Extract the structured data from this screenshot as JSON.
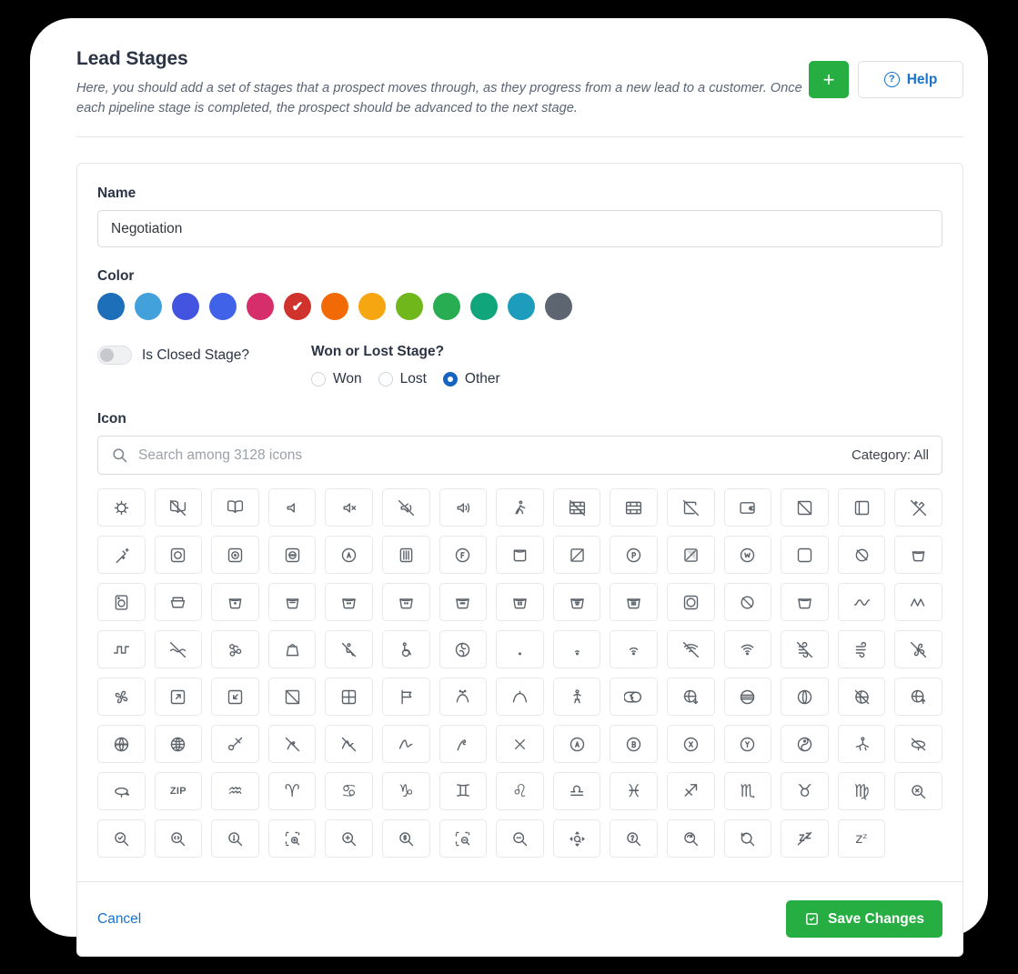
{
  "header": {
    "title": "Lead Stages",
    "description": "Here, you should add a set of stages that a prospect moves through, as they progress from a new lead to a customer. Once each pipeline stage is completed, the prospect should be advanced to the next stage.",
    "add_label": "+",
    "add_icon": "plus-icon",
    "help_label": "Help",
    "help_icon": "question-circle-icon",
    "accent_green": "#27ae42",
    "accent_blue": "#1a73c9"
  },
  "form": {
    "name_label": "Name",
    "name_value": "Negotiation",
    "name_placeholder": "",
    "color_label": "Color",
    "colors": [
      {
        "hex": "#1c6fb8",
        "selected": false
      },
      {
        "hex": "#42a0da",
        "selected": false
      },
      {
        "hex": "#4355e0",
        "selected": false
      },
      {
        "hex": "#4062e8",
        "selected": false
      },
      {
        "hex": "#d52e6a",
        "selected": false
      },
      {
        "hex": "#d0332c",
        "selected": true
      },
      {
        "hex": "#f26a06",
        "selected": false
      },
      {
        "hex": "#f5a611",
        "selected": false
      },
      {
        "hex": "#6fb71b",
        "selected": false
      },
      {
        "hex": "#29ad52",
        "selected": false
      },
      {
        "hex": "#11a57c",
        "selected": false
      },
      {
        "hex": "#1e9cbb",
        "selected": false
      },
      {
        "hex": "#5d6670",
        "selected": false
      }
    ],
    "selected_check": "✔",
    "toggle_label": "Is Closed Stage?",
    "toggle_on": false,
    "radio_title": "Won or Lost Stage?",
    "radios": [
      {
        "label": "Won",
        "selected": false
      },
      {
        "label": "Lost",
        "selected": false
      },
      {
        "label": "Other",
        "selected": true
      }
    ],
    "radio_selected_color": "#1565c0",
    "icon_label": "Icon",
    "search_placeholder": "Search among 3128 icons",
    "search_value": "",
    "search_icon": "search-icon",
    "category_text": "Category: All"
  },
  "icon_grid": {
    "rows": [
      [
        {
          "name": "virus-icon",
          "type": "svg",
          "id": "virus"
        },
        {
          "name": "book-off-icon",
          "type": "svg",
          "id": "book-off"
        },
        {
          "name": "book-open-icon",
          "type": "svg",
          "id": "book-open"
        },
        {
          "name": "volume-icon",
          "type": "svg",
          "id": "volume"
        },
        {
          "name": "volume-x-icon",
          "type": "svg",
          "id": "volume-x"
        },
        {
          "name": "volume-off-icon",
          "type": "svg",
          "id": "volume-off"
        },
        {
          "name": "volume-high-icon",
          "type": "svg",
          "id": "volume-high"
        },
        {
          "name": "walk-icon",
          "type": "svg",
          "id": "walk"
        },
        {
          "name": "wall-off-icon",
          "type": "svg",
          "id": "wall-off"
        },
        {
          "name": "wall-icon",
          "type": "svg",
          "id": "wall"
        },
        {
          "name": "wallet-off-icon",
          "type": "svg",
          "id": "wallet-off"
        },
        {
          "name": "wallet-icon",
          "type": "svg",
          "id": "wallet"
        },
        {
          "name": "wallpaper-off-icon",
          "type": "svg",
          "id": "wallpaper-off"
        },
        {
          "name": "wallpaper-icon",
          "type": "svg",
          "id": "wallpaper"
        },
        {
          "name": "wand-off-icon",
          "type": "svg",
          "id": "wand-off"
        },
        {
          "name": "wand-icon",
          "type": "svg",
          "id": "wand"
        },
        {
          "name": "wash-dry-icon",
          "type": "svg",
          "id": "wash-dry-circle"
        }
      ],
      [
        {
          "name": "wash-dry-1-icon",
          "type": "svg",
          "id": "wash-dry-1"
        },
        {
          "name": "wash-dry-3-icon",
          "type": "svg",
          "id": "wash-dry-3"
        },
        {
          "name": "wash-dry-a-icon",
          "type": "svg",
          "id": "wash-dry-a"
        },
        {
          "name": "wash-dry-dip-icon",
          "type": "svg",
          "id": "wash-dry-dip"
        },
        {
          "name": "wash-dry-f-icon",
          "type": "svg",
          "id": "wash-dry-f"
        },
        {
          "name": "wash-dry-hang-icon",
          "type": "svg",
          "id": "wash-dry-hang"
        },
        {
          "name": "wash-dry-off-icon",
          "type": "svg",
          "id": "wash-dry-off"
        },
        {
          "name": "wash-dry-p-icon",
          "type": "svg",
          "id": "wash-dry-p"
        },
        {
          "name": "wash-dry-shade-icon",
          "type": "svg",
          "id": "wash-dry-shade"
        },
        {
          "name": "wash-dry-w-icon",
          "type": "svg",
          "id": "wash-dry-w"
        },
        {
          "name": "wash-dryclean-icon",
          "type": "svg",
          "id": "wash-dryclean"
        },
        {
          "name": "wash-dryclean-off-icon",
          "type": "svg",
          "id": "wash-dryclean-off"
        },
        {
          "name": "wash-gentle-icon",
          "type": "svg",
          "id": "wash-gentle"
        },
        {
          "name": "wash-machine-icon",
          "type": "svg",
          "id": "wash-machine"
        },
        {
          "name": "wash-press-icon",
          "type": "svg",
          "id": "wash-press"
        },
        {
          "name": "wash-temp-icon",
          "type": "svg",
          "id": "wash-temp"
        },
        {
          "name": "wash-basket-icon",
          "type": "svg",
          "id": "wash-basket"
        }
      ],
      [
        {
          "name": "wash-temp-1-icon",
          "type": "svg",
          "id": "wash-t1"
        },
        {
          "name": "wash-temp-2-icon",
          "type": "svg",
          "id": "wash-t2"
        },
        {
          "name": "wash-temp-3-icon",
          "type": "svg",
          "id": "wash-t3"
        },
        {
          "name": "wash-temp-4-icon",
          "type": "svg",
          "id": "wash-t4"
        },
        {
          "name": "wash-temp-5-icon",
          "type": "svg",
          "id": "wash-t5"
        },
        {
          "name": "wash-temp-6-icon",
          "type": "svg",
          "id": "wash-t6"
        },
        {
          "name": "wash-tumble-dry-icon",
          "type": "svg",
          "id": "wash-tumble"
        },
        {
          "name": "wash-tumble-off-icon",
          "type": "svg",
          "id": "wash-tumble-off"
        },
        {
          "name": "wash-plain-icon",
          "type": "svg",
          "id": "wash-plain"
        },
        {
          "name": "wave-sine-icon",
          "type": "svg",
          "id": "wave-sine"
        },
        {
          "name": "wave-sawtooth-icon",
          "type": "svg",
          "id": "wave-saw"
        },
        {
          "name": "wave-square-icon",
          "type": "svg",
          "id": "wave-square"
        },
        {
          "name": "waves-off-icon",
          "type": "svg",
          "id": "waves-off"
        },
        {
          "name": "webhook-icon",
          "type": "svg",
          "id": "webhook"
        },
        {
          "name": "weight-icon",
          "type": "svg",
          "id": "weight"
        },
        {
          "name": "wheelchair-off-icon",
          "type": "svg",
          "id": "wheelchair-off"
        },
        {
          "name": "wheelchair-icon",
          "type": "svg",
          "id": "wheelchair"
        }
      ],
      [
        {
          "name": "whirl-icon",
          "type": "svg",
          "id": "whirl"
        },
        {
          "name": "wifi-0-icon",
          "type": "svg",
          "id": "wifi0"
        },
        {
          "name": "wifi-1-icon",
          "type": "svg",
          "id": "wifi1"
        },
        {
          "name": "wifi-2-icon",
          "type": "svg",
          "id": "wifi2"
        },
        {
          "name": "wifi-off-icon",
          "type": "svg",
          "id": "wifi-off"
        },
        {
          "name": "wifi-icon",
          "type": "svg",
          "id": "wifi"
        },
        {
          "name": "wind-off-icon",
          "type": "svg",
          "id": "wind-off"
        },
        {
          "name": "wind-icon",
          "type": "svg",
          "id": "wind"
        },
        {
          "name": "windmill-off-icon",
          "type": "svg",
          "id": "windmill-off"
        },
        {
          "name": "windmill-icon",
          "type": "svg",
          "id": "windmill"
        },
        {
          "name": "window-maximize-icon",
          "type": "svg",
          "id": "win-max"
        },
        {
          "name": "window-minimize-icon",
          "type": "svg",
          "id": "win-min"
        },
        {
          "name": "window-off-icon",
          "type": "svg",
          "id": "win-off"
        },
        {
          "name": "window-icon",
          "type": "svg",
          "id": "window"
        },
        {
          "name": "windsock-icon",
          "type": "svg",
          "id": "windsock"
        },
        {
          "name": "wiper-wash-icon",
          "type": "svg",
          "id": "wiper-wash"
        },
        {
          "name": "wiper-icon",
          "type": "svg",
          "id": "wiper"
        }
      ],
      [
        {
          "name": "woman-icon",
          "type": "svg",
          "id": "woman"
        },
        {
          "name": "wood-icon",
          "type": "svg",
          "id": "wood"
        },
        {
          "name": "world-download-icon",
          "type": "svg",
          "id": "world-dl"
        },
        {
          "name": "world-latitude-icon",
          "type": "svg",
          "id": "world-lat"
        },
        {
          "name": "world-longitude-icon",
          "type": "svg",
          "id": "world-lon"
        },
        {
          "name": "world-off-icon",
          "type": "svg",
          "id": "world-off"
        },
        {
          "name": "world-upload-icon",
          "type": "svg",
          "id": "world-ul"
        },
        {
          "name": "world-www-icon",
          "type": "svg",
          "id": "world-www"
        },
        {
          "name": "world-icon",
          "type": "svg",
          "id": "world"
        },
        {
          "name": "wrecking-ball-icon",
          "type": "svg",
          "id": "wrecking"
        },
        {
          "name": "writing-off-icon",
          "type": "svg",
          "id": "writing-off"
        },
        {
          "name": "writing-sign-off-icon",
          "type": "svg",
          "id": "writing-sign-off"
        },
        {
          "name": "writing-sign-icon",
          "type": "svg",
          "id": "writing-sign"
        },
        {
          "name": "writing-icon",
          "type": "svg",
          "id": "writing"
        },
        {
          "name": "x-icon",
          "type": "svg",
          "id": "x"
        },
        {
          "name": "xbox-a-icon",
          "type": "svg",
          "id": "xbox-a"
        },
        {
          "name": "xbox-b-icon",
          "type": "svg",
          "id": "xbox-b"
        }
      ],
      [
        {
          "name": "xbox-x-icon",
          "type": "svg",
          "id": "xbox-x"
        },
        {
          "name": "xbox-y-icon",
          "type": "svg",
          "id": "xbox-y"
        },
        {
          "name": "yin-yang-icon",
          "type": "svg",
          "id": "yinyang"
        },
        {
          "name": "yoga-icon",
          "type": "svg",
          "id": "yoga"
        },
        {
          "name": "zeppelin-off-icon",
          "type": "svg",
          "id": "zeppelin-off"
        },
        {
          "name": "zeppelin-icon",
          "type": "svg",
          "id": "zeppelin"
        },
        {
          "name": "zip-icon",
          "type": "text",
          "text": "ZIP"
        },
        {
          "name": "zodiac-aquarius-icon",
          "type": "glyph",
          "glyph": "♒"
        },
        {
          "name": "zodiac-aries-icon",
          "type": "glyph",
          "glyph": "♈"
        },
        {
          "name": "zodiac-cancer-icon",
          "type": "glyph",
          "glyph": "♋"
        },
        {
          "name": "zodiac-capricorn-icon",
          "type": "glyph",
          "glyph": "♑"
        },
        {
          "name": "zodiac-gemini-icon",
          "type": "glyph",
          "glyph": "♊"
        },
        {
          "name": "zodiac-leo-icon",
          "type": "glyph",
          "glyph": "♌"
        },
        {
          "name": "zodiac-libra-icon",
          "type": "glyph",
          "glyph": "♎"
        },
        {
          "name": "zodiac-pisces-icon",
          "type": "glyph",
          "glyph": "♓"
        },
        {
          "name": "zodiac-sagittarius-icon",
          "type": "glyph",
          "glyph": "♐"
        },
        {
          "name": "zodiac-scorpio-icon",
          "type": "glyph",
          "glyph": "♏"
        }
      ],
      [
        {
          "name": "zodiac-taurus-icon",
          "type": "glyph",
          "glyph": "♉"
        },
        {
          "name": "zodiac-virgo-icon",
          "type": "glyph",
          "glyph": "♍"
        },
        {
          "name": "zoom-cancel-icon",
          "type": "svg",
          "id": "zoom-cancel"
        },
        {
          "name": "zoom-check-icon",
          "type": "svg",
          "id": "zoom-check"
        },
        {
          "name": "zoom-code-icon",
          "type": "svg",
          "id": "zoom-code"
        },
        {
          "name": "zoom-exclamation-icon",
          "type": "svg",
          "id": "zoom-excl"
        },
        {
          "name": "zoom-in-area-icon",
          "type": "svg",
          "id": "zoom-in-area"
        },
        {
          "name": "zoom-in-icon",
          "type": "svg",
          "id": "zoom-in"
        },
        {
          "name": "zoom-money-icon",
          "type": "svg",
          "id": "zoom-money"
        },
        {
          "name": "zoom-out-area-icon",
          "type": "svg",
          "id": "zoom-out-area"
        },
        {
          "name": "zoom-out-icon",
          "type": "svg",
          "id": "zoom-out"
        },
        {
          "name": "zoom-pan-icon",
          "type": "svg",
          "id": "zoom-pan"
        },
        {
          "name": "zoom-question-icon",
          "type": "svg",
          "id": "zoom-question"
        },
        {
          "name": "zoom-replace-icon",
          "type": "svg",
          "id": "zoom-replace"
        },
        {
          "name": "zoom-reset-icon",
          "type": "svg",
          "id": "zoom-reset"
        },
        {
          "name": "zzz-off-icon",
          "type": "svg",
          "id": "zzz-off"
        },
        {
          "name": "zzz-icon",
          "type": "glyph-sm",
          "glyph": "zᶻ"
        }
      ]
    ]
  },
  "footer": {
    "cancel_label": "Cancel",
    "save_label": "Save Changes",
    "save_icon": "checkbox-icon"
  }
}
